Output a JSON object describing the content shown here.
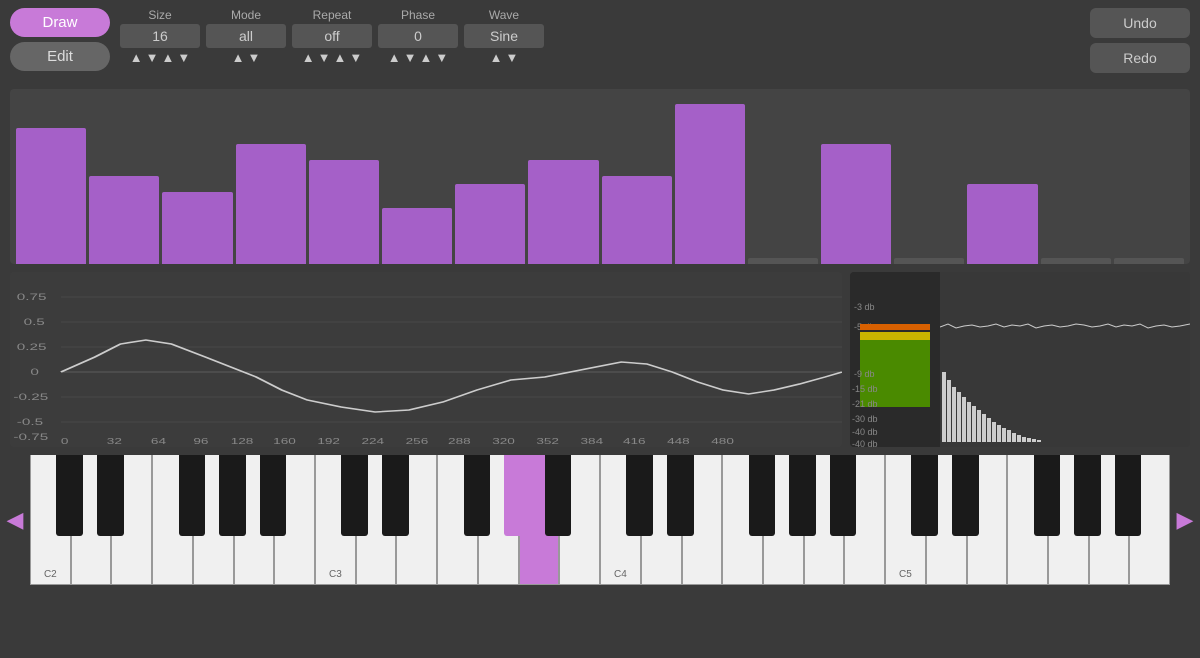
{
  "toolbar": {
    "draw_label": "Draw",
    "edit_label": "Edit",
    "size_label": "Size",
    "size_value": "16",
    "mode_label": "Mode",
    "mode_value": "all",
    "repeat_label": "Repeat",
    "repeat_value": "off",
    "phase_label": "Phase",
    "phase_value": "0",
    "wave_label": "Wave",
    "wave_value": "Sine",
    "undo_label": "Undo",
    "redo_label": "Redo"
  },
  "sequencer": {
    "steps": [
      85,
      55,
      45,
      75,
      65,
      35,
      50,
      65,
      55,
      100,
      0,
      75,
      0,
      50,
      0,
      0
    ]
  },
  "waveform": {
    "y_labels": [
      "0.75",
      "0.5",
      "0.25",
      "0",
      "-0.25",
      "-0.5",
      "-0.75"
    ],
    "x_labels": [
      "0",
      "32",
      "64",
      "96",
      "128",
      "160",
      "192",
      "224",
      "256",
      "288",
      "320",
      "352",
      "384",
      "416",
      "448",
      "480"
    ]
  },
  "spectrum": {
    "db_labels": [
      "-3 db",
      "-5 db",
      "-9 db",
      "-15 db",
      "-21 db",
      "-30 db",
      "-40 db",
      "-40 db"
    ],
    "wave_label": ""
  },
  "piano": {
    "nav_left": "◀",
    "nav_right": "▶",
    "octave_labels": [
      "C2",
      "C3",
      "C4",
      "C5"
    ],
    "active_key": "C4_black"
  },
  "colors": {
    "purple": "#c87ad8",
    "dark_purple": "#a560c8",
    "bg": "#3a3a3a",
    "panel": "#404040",
    "btn_bg": "#555555"
  }
}
